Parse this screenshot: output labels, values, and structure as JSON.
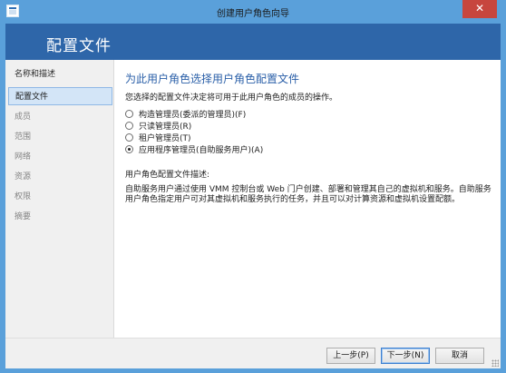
{
  "window": {
    "title": "创建用户角色向导",
    "close_glyph": "✕",
    "frame_color": "#5aa0da"
  },
  "header": {
    "title": "配置文件",
    "band_color": "#2e66a9"
  },
  "nav": {
    "items": [
      {
        "label": "名称和描述",
        "state": "done"
      },
      {
        "label": "配置文件",
        "state": "active"
      },
      {
        "label": "成员",
        "state": "pending"
      },
      {
        "label": "范围",
        "state": "pending"
      },
      {
        "label": "网络",
        "state": "pending"
      },
      {
        "label": "资源",
        "state": "pending"
      },
      {
        "label": "权限",
        "state": "pending"
      },
      {
        "label": "摘要",
        "state": "pending"
      }
    ]
  },
  "main": {
    "title": "为此用户角色选择用户角色配置文件",
    "description": "您选择的配置文件决定将可用于此用户角色的成员的操作。",
    "options": [
      {
        "label": "构造管理员(委派的管理员)(F)",
        "checked": false
      },
      {
        "label": "只读管理员(R)",
        "checked": false
      },
      {
        "label": "租户管理员(T)",
        "checked": false
      },
      {
        "label": "应用程序管理员(自助服务用户)(A)",
        "checked": true
      }
    ],
    "profile_desc_heading": "用户角色配置文件描述:",
    "profile_desc_body": "自助服务用户通过使用 VMM 控制台或 Web 门户创建、部署和管理其自己的虚拟机和服务。自助服务用户角色指定用户可对其虚拟机和服务执行的任务，并且可以对计算资源和虚拟机设置配额。"
  },
  "footer": {
    "prev_label": "上一步(P)",
    "next_label": "下一步(N)",
    "cancel_label": "取消"
  }
}
